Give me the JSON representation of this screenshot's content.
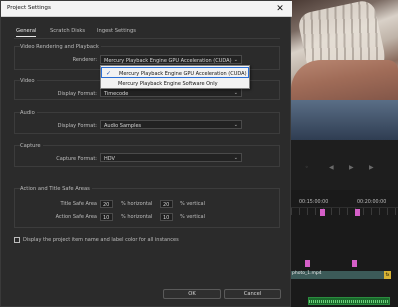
{
  "dialog": {
    "title": "Project Settings",
    "close_glyph": "✕",
    "tabs": [
      "General",
      "Scratch Disks",
      "Ingest Settings"
    ],
    "active_tab": "General"
  },
  "sections": {
    "video_rendering": {
      "title": "Video Rendering and Playback",
      "renderer_label": "Renderer:",
      "renderer_value": "Mercury Playback Engine GPU Acceleration (CUDA)"
    },
    "video": {
      "title": "Video",
      "display_format_label": "Display Format:",
      "display_format_value": "Timecode"
    },
    "audio": {
      "title": "Audio",
      "display_format_label": "Display Format:",
      "display_format_value": "Audio Samples"
    },
    "capture": {
      "title": "Capture",
      "capture_format_label": "Capture Format:",
      "capture_format_value": "HDV"
    },
    "safe_areas": {
      "title": "Action and Title Safe Areas",
      "title_safe_label": "Title Safe Area",
      "title_safe_h": "20",
      "title_safe_v": "20",
      "action_safe_label": "Action Safe Area",
      "action_safe_h": "10",
      "action_safe_v": "10",
      "horizontal_unit": "% horizontal",
      "vertical_unit": "% vertical"
    }
  },
  "checkbox_label": "Display the project item name and label color for all instances",
  "buttons": {
    "ok": "OK",
    "cancel": "Cancel"
  },
  "renderer_menu": {
    "options": [
      "Mercury Playback Engine GPU Acceleration (CUDA)",
      "Mercury Playback Engine Software Only"
    ],
    "selected_index": 0,
    "check_glyph": "✓"
  },
  "background_app": {
    "timecode_left": "00:15:00:00",
    "timecode_right": "00:20:00:00",
    "clip_name": "photo_1.mp4",
    "fx_badge": "fx"
  },
  "icons": {
    "chevron": "⌄",
    "transport": [
      "⏺",
      "◀",
      "▶",
      "▶▶"
    ]
  },
  "colors": {
    "marker": "#d55fc8",
    "fx_badge": "#d7b334",
    "audio_clip": "#1a6a2c",
    "menu_highlight_border": "#2a6fd6"
  }
}
